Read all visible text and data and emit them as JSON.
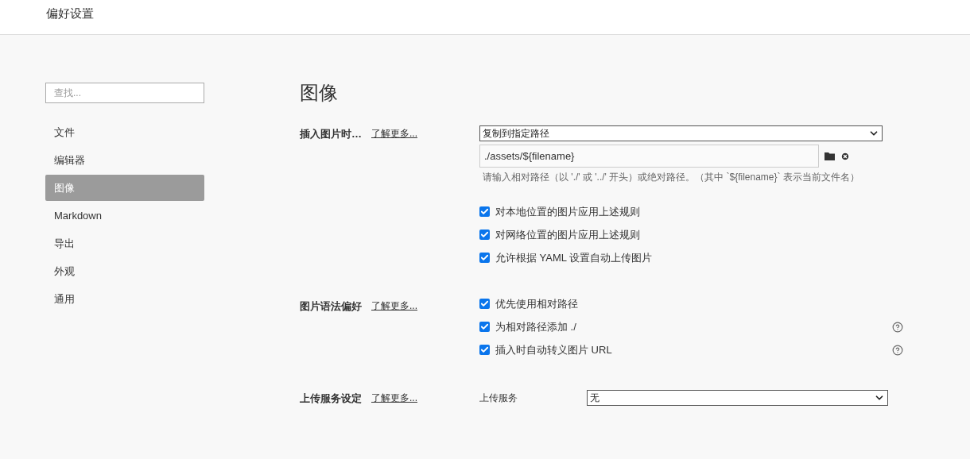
{
  "window": {
    "title": "偏好设置"
  },
  "sidebar": {
    "search": {
      "placeholder": "查找..."
    },
    "items": [
      {
        "label": "文件",
        "selected": false
      },
      {
        "label": "编辑器",
        "selected": false
      },
      {
        "label": "图像",
        "selected": true
      },
      {
        "label": "Markdown",
        "selected": false
      },
      {
        "label": "导出",
        "selected": false
      },
      {
        "label": "外观",
        "selected": false
      },
      {
        "label": "通用",
        "selected": false
      }
    ]
  },
  "content": {
    "heading": "图像",
    "sections": [
      {
        "label": "插入图片时…",
        "link": "了解更多...",
        "controls": [
          {
            "kind": "select",
            "value": "复制到指定路径"
          },
          {
            "kind": "path",
            "value": "./assets/${filename}",
            "hint": "请输入相对路径（以 './' 或 '../' 开头）或绝对路径。（其中 `${filename}` 表示当前文件名）"
          },
          {
            "kind": "checkbox",
            "label": "对本地位置的图片应用上述规则",
            "checked": true,
            "help": false
          },
          {
            "kind": "checkbox",
            "label": "对网络位置的图片应用上述规则",
            "checked": true,
            "help": false
          },
          {
            "kind": "checkbox",
            "label": "允许根据 YAML 设置自动上传图片",
            "checked": true,
            "help": false
          }
        ]
      },
      {
        "label": "图片语法偏好",
        "link": "了解更多...",
        "controls": [
          {
            "kind": "checkbox",
            "label": "优先使用相对路径",
            "checked": true,
            "help": false
          },
          {
            "kind": "checkbox",
            "label": "为相对路径添加 ./",
            "checked": true,
            "help": true
          },
          {
            "kind": "checkbox",
            "label": "插入时自动转义图片 URL",
            "checked": true,
            "help": true
          }
        ]
      },
      {
        "label": "上传服务设定",
        "link": "了解更多...",
        "controls": [
          {
            "kind": "labeled_select",
            "label": "上传服务",
            "value": "无"
          }
        ]
      }
    ]
  }
}
